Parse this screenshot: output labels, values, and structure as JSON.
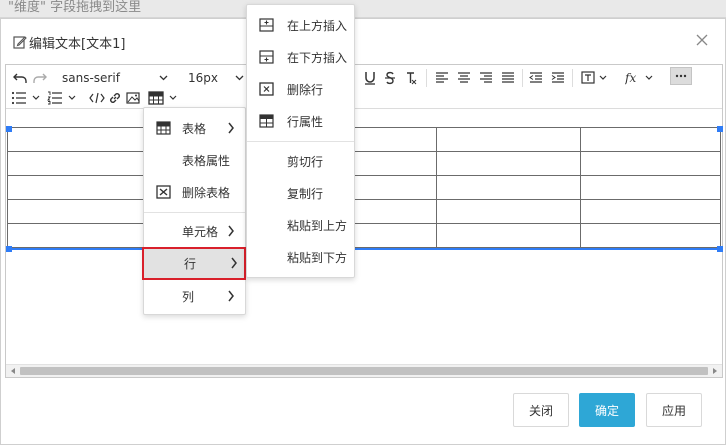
{
  "background": {
    "hint": "\"维度\" 字段拖拽到这里"
  },
  "dialog": {
    "title": "编辑文本[文本1]",
    "buttons": {
      "close": "关闭",
      "confirm": "确定",
      "apply": "应用"
    }
  },
  "toolbar": {
    "font_family": "sans-serif",
    "font_size": "16px"
  },
  "table_menu": {
    "items": [
      {
        "label": "表格",
        "icon": "table-icon",
        "submenu": true
      },
      {
        "label": "表格属性",
        "icon": "",
        "submenu": false
      },
      {
        "label": "删除表格",
        "icon": "delete-table-icon",
        "submenu": false
      },
      {
        "label": "单元格",
        "icon": "",
        "submenu": true
      },
      {
        "label": "行",
        "icon": "",
        "submenu": true,
        "highlighted": true
      },
      {
        "label": "列",
        "icon": "",
        "submenu": true
      }
    ]
  },
  "row_menu": {
    "items": [
      {
        "label": "在上方插入",
        "icon": "insert-row-above-icon"
      },
      {
        "label": "在下方插入",
        "icon": "insert-row-below-icon"
      },
      {
        "label": "删除行",
        "icon": "delete-row-icon"
      },
      {
        "label": "行属性",
        "icon": "row-properties-icon"
      },
      {
        "label": "剪切行",
        "icon": ""
      },
      {
        "label": "复制行",
        "icon": ""
      },
      {
        "label": "粘贴到上方",
        "icon": ""
      },
      {
        "label": "粘贴到下方",
        "icon": ""
      }
    ]
  },
  "colors": {
    "primary": "#2ea7d6",
    "highlight_border": "#d9202b",
    "selection": "#2f7cf6"
  }
}
